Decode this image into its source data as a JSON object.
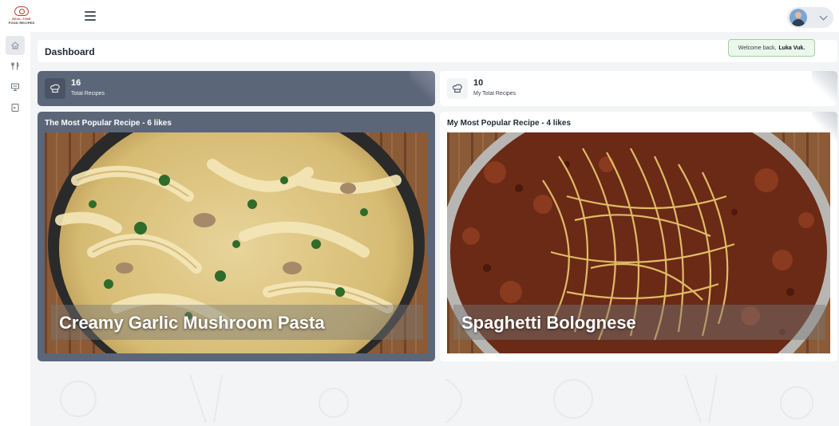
{
  "brand": {
    "logo_line1": "REAL-TIME",
    "logo_line2": "FOOD RECIPES",
    "accent": "#c0392b"
  },
  "topbar": {
    "menu_icon": "hamburger-icon",
    "user_chevron_icon": "chevron-down-icon"
  },
  "sidebar": {
    "items": [
      {
        "name": "dashboard",
        "icon": "home-icon",
        "active": true
      },
      {
        "name": "recipes",
        "icon": "utensils-icon",
        "active": false
      },
      {
        "name": "my-recipes",
        "icon": "monitor-icon",
        "active": false
      },
      {
        "name": "logout",
        "icon": "logout-icon",
        "active": false
      }
    ]
  },
  "header": {
    "title": "Dashboard"
  },
  "welcome": {
    "prefix": "Welcome back,",
    "user": "Luka Vuk."
  },
  "stats": [
    {
      "value": "16",
      "label": "Total Recipes",
      "icon": "chef-hat-icon"
    },
    {
      "value": "10",
      "label": "My Total Recipes",
      "icon": "chef-hat-icon"
    }
  ],
  "popular": {
    "heading": "The Most Popular Recipe - 6 likes",
    "recipe_name": "Creamy Garlic Mushroom Pasta"
  },
  "my_popular": {
    "heading": "My Most Popular Recipe - 4 likes",
    "recipe_name": "Spaghetti Bolognese"
  },
  "colors": {
    "dark_card": "#5b6678",
    "welcome_bg": "#eaf7ea",
    "welcome_border": "#9ed39e"
  }
}
